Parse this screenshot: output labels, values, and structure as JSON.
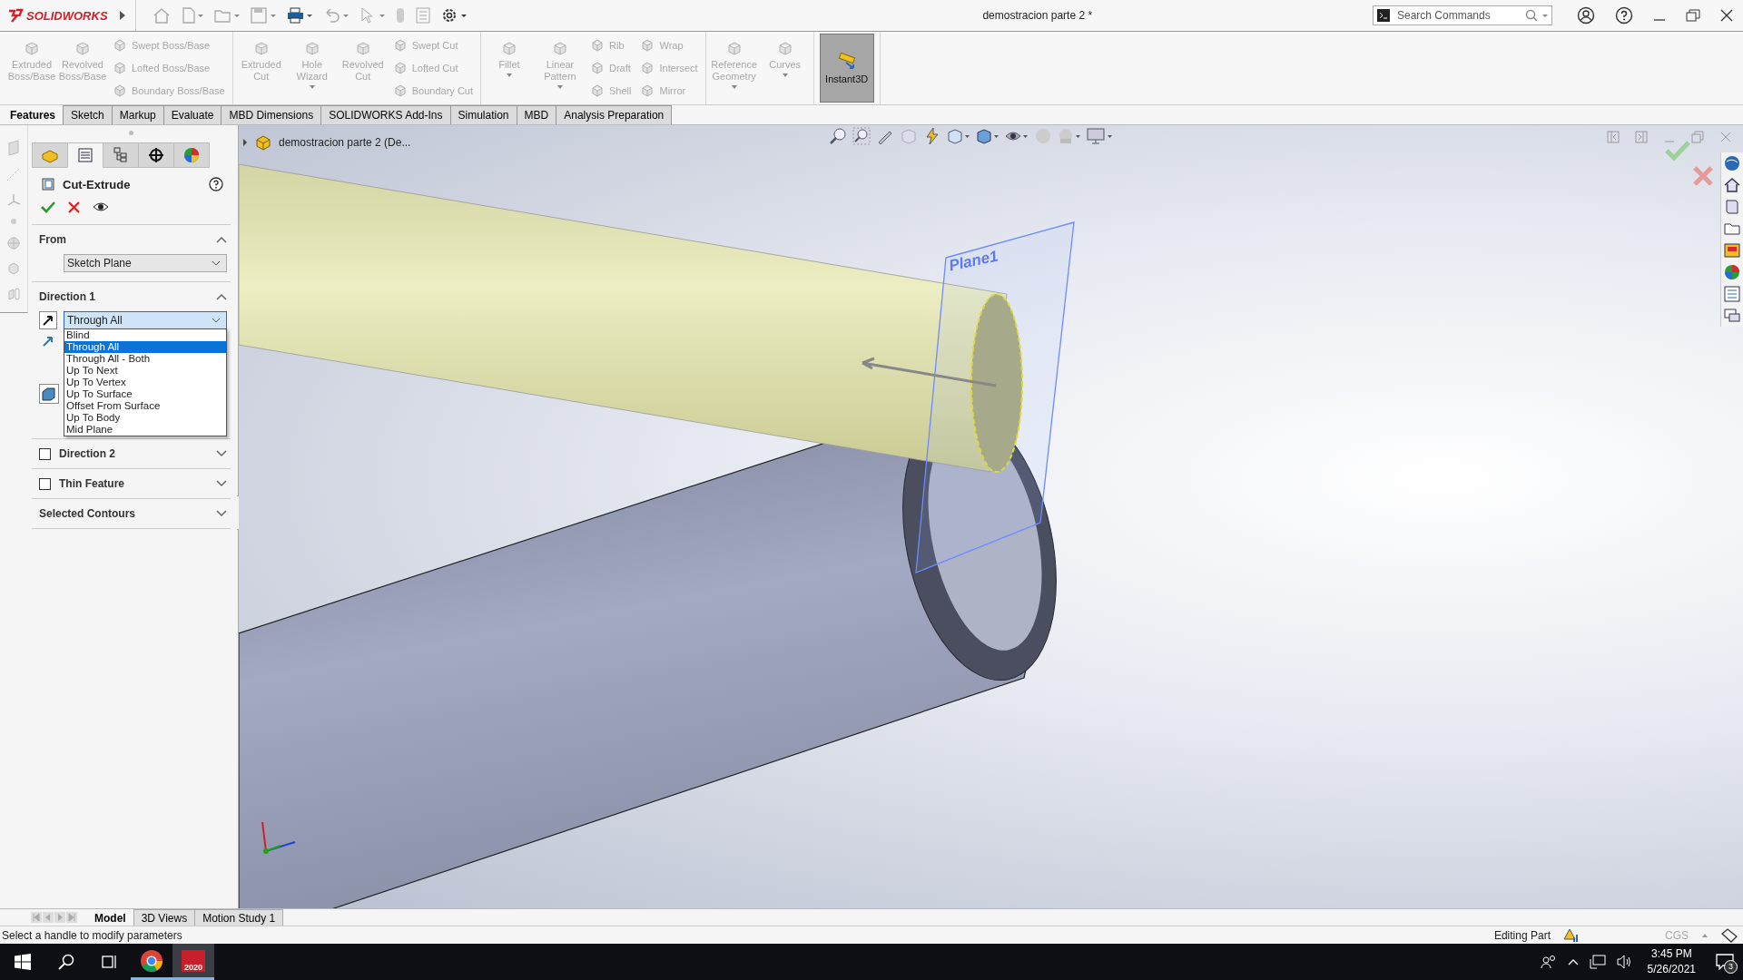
{
  "title_bar": {
    "app_name": "SOLIDWORKS",
    "document_title": "demostracion parte 2 *",
    "search": {
      "placeholder": "Search Commands"
    }
  },
  "ribbon": {
    "groups": [
      {
        "columns": [
          {
            "kind": "large",
            "label": "Extruded Boss/Base",
            "disabled": true,
            "caret": false
          },
          {
            "kind": "large",
            "label": "Revolved Boss/Base",
            "disabled": true,
            "caret": false
          },
          {
            "kind": "stack",
            "items": [
              {
                "label": "Swept Boss/Base",
                "disabled": true
              },
              {
                "label": "Lofted Boss/Base",
                "disabled": true
              },
              {
                "label": "Boundary Boss/Base",
                "disabled": true
              }
            ]
          }
        ]
      },
      {
        "columns": [
          {
            "kind": "large",
            "label": "Extruded Cut",
            "disabled": true,
            "caret": false
          },
          {
            "kind": "large",
            "label": "Hole Wizard",
            "disabled": true,
            "caret": true
          },
          {
            "kind": "large",
            "label": "Revolved Cut",
            "disabled": true,
            "caret": false
          },
          {
            "kind": "stack",
            "items": [
              {
                "label": "Swept Cut",
                "disabled": true
              },
              {
                "label": "Lofted Cut",
                "disabled": true
              },
              {
                "label": "Boundary Cut",
                "disabled": true
              }
            ]
          }
        ]
      },
      {
        "columns": [
          {
            "kind": "large",
            "label": "Fillet",
            "disabled": true,
            "caret": true
          },
          {
            "kind": "large",
            "label": "Linear Pattern",
            "disabled": true,
            "caret": true
          },
          {
            "kind": "stack",
            "items": [
              {
                "label": "Rib",
                "disabled": true
              },
              {
                "label": "Draft",
                "disabled": true
              },
              {
                "label": "Shell",
                "disabled": true
              }
            ]
          },
          {
            "kind": "stack",
            "items": [
              {
                "label": "Wrap",
                "disabled": true
              },
              {
                "label": "Intersect",
                "disabled": true
              },
              {
                "label": "Mirror",
                "disabled": true
              }
            ]
          }
        ]
      },
      {
        "columns": [
          {
            "kind": "large",
            "label": "Reference Geometry",
            "disabled": true,
            "caret": true
          },
          {
            "kind": "large",
            "label": "Curves",
            "disabled": true,
            "caret": true
          }
        ]
      },
      {
        "columns": [
          {
            "kind": "toggle",
            "label": "Instant3D",
            "selected": true
          }
        ]
      }
    ]
  },
  "tabs": [
    {
      "label": "Features",
      "selected": true
    },
    {
      "label": "Sketch",
      "selected": false
    },
    {
      "label": "Markup",
      "selected": false
    },
    {
      "label": "Evaluate",
      "selected": false
    },
    {
      "label": "MBD Dimensions",
      "selected": false
    },
    {
      "label": "SOLIDWORKS Add-Ins",
      "selected": false
    },
    {
      "label": "Simulation",
      "selected": false
    },
    {
      "label": "MBD",
      "selected": false
    },
    {
      "label": "Analysis Preparation",
      "selected": false
    }
  ],
  "property_manager": {
    "panel_tabs": [
      {
        "selected": false
      },
      {
        "selected": true
      },
      {
        "selected": false
      },
      {
        "selected": false
      },
      {
        "selected": false
      }
    ],
    "title": "Cut-Extrude",
    "sections": [
      {
        "kind": "dropdown",
        "title": "From",
        "expanded": true,
        "value": "Sketch Plane"
      },
      {
        "kind": "direction",
        "title": "Direction 1",
        "expanded": true,
        "value": "Through All",
        "options": [
          {
            "label": "Blind",
            "selected": false
          },
          {
            "label": "Through All",
            "selected": true
          },
          {
            "label": "Through All - Both",
            "selected": false
          },
          {
            "label": "Up To Next",
            "selected": false
          },
          {
            "label": "Up To Vertex",
            "selected": false
          },
          {
            "label": "Up To Surface",
            "selected": false
          },
          {
            "label": "Offset From Surface",
            "selected": false
          },
          {
            "label": "Up To Body",
            "selected": false
          },
          {
            "label": "Mid Plane",
            "selected": false
          }
        ]
      },
      {
        "kind": "checkbox",
        "title": "Direction 2",
        "checked": false,
        "expanded": false
      },
      {
        "kind": "checkbox",
        "title": "Thin Feature",
        "checked": false,
        "expanded": false
      },
      {
        "kind": "plain",
        "title": "Selected Contours",
        "expanded": false
      }
    ]
  },
  "viewport": {
    "breadcrumb": "demostracion parte 2  (De...",
    "plane_label": "Plane1"
  },
  "bottom_tabs": [
    {
      "label": "Model",
      "selected": true
    },
    {
      "label": "3D Views",
      "selected": false
    },
    {
      "label": "Motion Study 1",
      "selected": false
    }
  ],
  "status_bar": {
    "message": "Select a handle to modify parameters",
    "mode": "Editing Part",
    "units": "CGS"
  },
  "taskbar": {
    "apps": [
      {
        "kind": "chrome",
        "selected": false
      },
      {
        "kind": "solidworks",
        "badge": "2020",
        "selected": true
      }
    ],
    "time": "3:45 PM",
    "date": "5/26/2021",
    "notifications": "3"
  }
}
